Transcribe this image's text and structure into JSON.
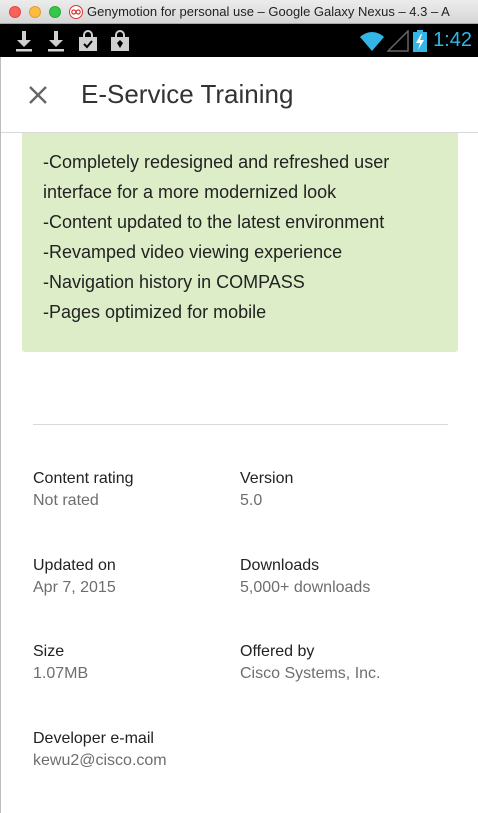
{
  "window": {
    "title": "Genymotion for personal use – Google Galaxy Nexus – 4.3 – A"
  },
  "status_bar": {
    "time": "1:42",
    "left_icons": [
      "download-icon",
      "download-icon",
      "shopping-bag-icon",
      "shopping-bag-icon"
    ],
    "right_icons": [
      "wifi-icon",
      "signal-icon",
      "battery-charging-icon"
    ],
    "accent_color": "#33b5e5"
  },
  "app_bar": {
    "title": "E-Service Training",
    "close_icon": "close-icon"
  },
  "whats_new": {
    "background_color": "#dcedc8",
    "lines": [
      "-Completely redesigned and refreshed user",
      "interface for a more modernized look",
      "-Content updated to the latest environment",
      "-Revamped video viewing experience",
      "-Navigation history in COMPASS",
      "-Pages optimized for mobile"
    ]
  },
  "info": {
    "content_rating": {
      "label": "Content rating",
      "value": "Not rated"
    },
    "version": {
      "label": "Version",
      "value": "5.0"
    },
    "updated_on": {
      "label": "Updated on",
      "value": "Apr 7, 2015"
    },
    "downloads": {
      "label": "Downloads",
      "value": "5,000+ downloads"
    },
    "size": {
      "label": "Size",
      "value": "1.07MB"
    },
    "offered_by": {
      "label": "Offered by",
      "value": "Cisco Systems, Inc."
    },
    "developer_email": {
      "label": "Developer e-mail",
      "value": "kewu2@cisco.com"
    }
  }
}
